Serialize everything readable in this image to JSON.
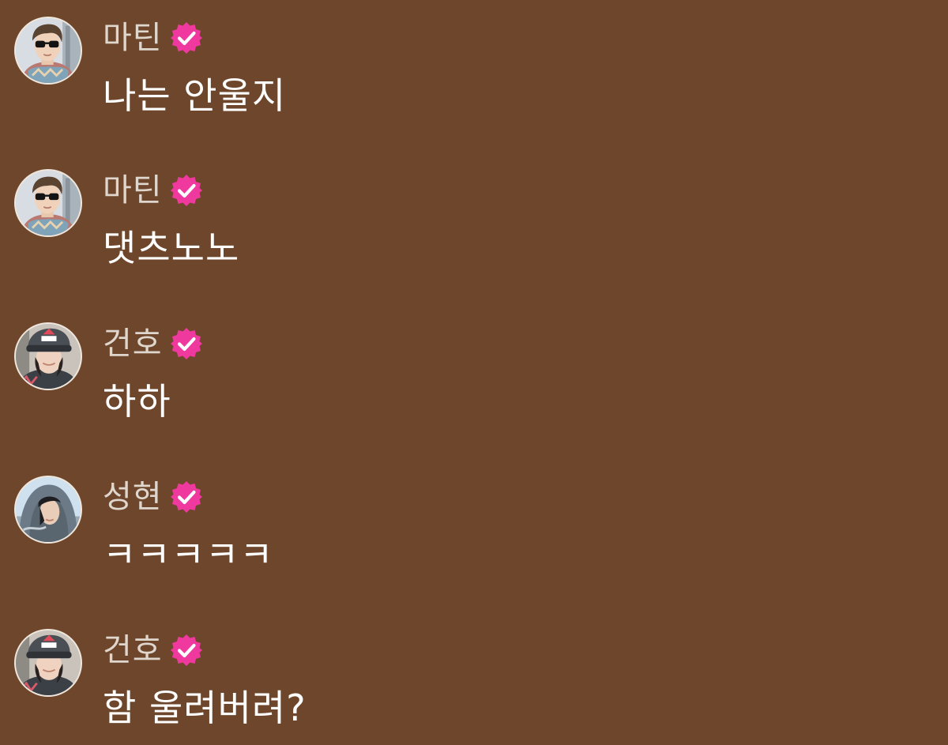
{
  "theme": {
    "background": "#6e462b",
    "name_color": "#dfd6cd",
    "text_color": "#ffffff",
    "badge_color": "#f0399e"
  },
  "messages": [
    {
      "sender": "마틴",
      "verified": true,
      "avatar": "avatar-sunglasses-icon",
      "text": "나는 안울지"
    },
    {
      "sender": "마틴",
      "verified": true,
      "avatar": "avatar-sunglasses-icon",
      "text": "댓츠노노"
    },
    {
      "sender": "건호",
      "verified": true,
      "avatar": "avatar-cap-icon",
      "text": "하하"
    },
    {
      "sender": "성현",
      "verified": true,
      "avatar": "avatar-hood-icon",
      "text": "ㅋㅋㅋㅋㅋ"
    },
    {
      "sender": "건호",
      "verified": true,
      "avatar": "avatar-cap-icon",
      "text": "함 울려버려?"
    }
  ]
}
